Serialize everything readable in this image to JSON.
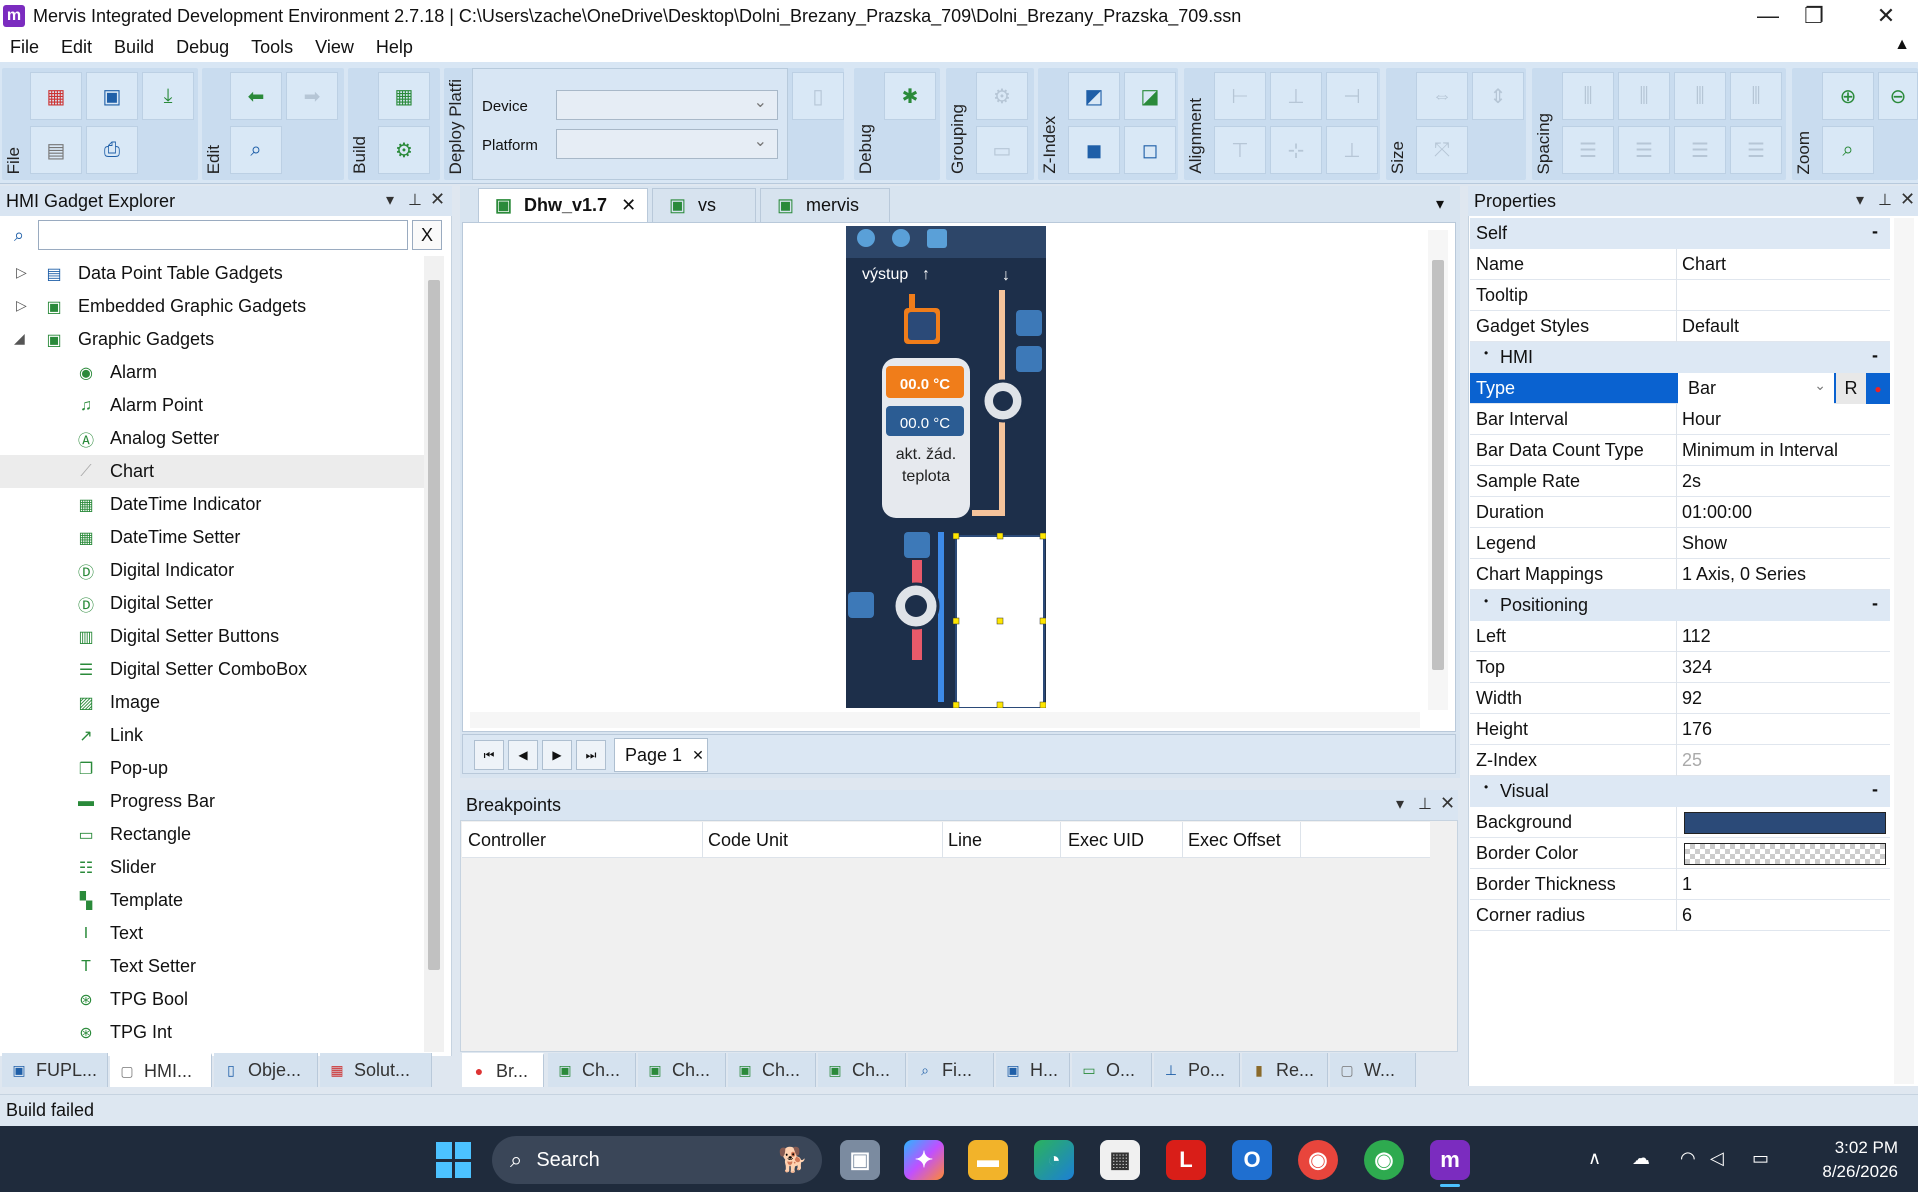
{
  "window": {
    "title": "Mervis Integrated Development Environment 2.7.18 | C:\\Users\\zache\\OneDrive\\Desktop\\Dolni_Brezany_Prazska_709\\Dolni_Brezany_Prazska_709.ssn",
    "logo": "m",
    "minimize": "—",
    "maximize": "❐",
    "close": "✕"
  },
  "menu": [
    "File",
    "Edit",
    "Build",
    "Debug",
    "Tools",
    "View",
    "Help"
  ],
  "menu_collapse": "▲",
  "toolbar": {
    "groups": [
      "File",
      "Edit",
      "Build",
      "Deploy Platfi",
      "Debug",
      "Grouping",
      "Z-Index",
      "Alignment",
      "Size",
      "Spacing",
      "Zoom"
    ],
    "device_label": "Device",
    "platform_label": "Platform",
    "device_value": "",
    "platform_value": ""
  },
  "left_panel": {
    "title": "HMI Gadget Explorer",
    "search_value": "",
    "clear_label": "X",
    "tree": {
      "group1": "Data Point Table Gadgets",
      "group2": "Embedded Graphic Gadgets",
      "group3": "Graphic Gadgets",
      "items": [
        "Alarm",
        "Alarm Point",
        "Analog Setter",
        "Chart",
        "DateTime Indicator",
        "DateTime Setter",
        "Digital Indicator",
        "Digital Setter",
        "Digital Setter Buttons",
        "Digital Setter ComboBox",
        "Image",
        "Link",
        "Pop-up",
        "Progress Bar",
        "Rectangle",
        "Slider",
        "Template",
        "Text",
        "Text Setter",
        "TPG Bool",
        "TPG Int"
      ]
    },
    "bottom_tabs": [
      "FUPL...",
      "HMI...",
      "Obje...",
      "Solut..."
    ]
  },
  "document": {
    "tabs": [
      "Dhw_v1.7",
      "vs",
      "mervis"
    ],
    "canvas": {
      "vystup": "výstup",
      "temp1": "00.0 °C",
      "temp2": "00.0 °C",
      "label_line1": "akt. žád.",
      "label_line2": "teplota"
    },
    "page_tab": "Page 1",
    "page_close": "✕"
  },
  "breakpoints": {
    "title": "Breakpoints",
    "columns": [
      "Controller",
      "Code Unit",
      "Line",
      "Exec UID",
      "Exec Offset"
    ],
    "bottom_tabs": [
      "Br...",
      "Ch...",
      "Ch...",
      "Ch...",
      "Ch...",
      "Fi...",
      "H...",
      "O...",
      "Po...",
      "Re...",
      "W..."
    ]
  },
  "properties": {
    "title": "Properties",
    "self_cat": "Self",
    "name_label": "Name",
    "name_value": "Chart",
    "tooltip_label": "Tooltip",
    "tooltip_value": "",
    "gstyles_label": "Gadget Styles",
    "gstyles_value": "Default",
    "hmi_cat": "HMI",
    "type_label": "Type",
    "type_value": "Bar",
    "type_r": "R",
    "barint_label": "Bar Interval",
    "barint_value": "Hour",
    "bardct_label": "Bar Data Count Type",
    "bardct_value": "Minimum in Interval",
    "srate_label": "Sample Rate",
    "srate_value": "2s",
    "dur_label": "Duration",
    "dur_value": "01:00:00",
    "legend_label": "Legend",
    "legend_value": "Show",
    "cmap_label": "Chart Mappings",
    "cmap_value": "1 Axis, 0 Series",
    "pos_cat": "Positioning",
    "left_label": "Left",
    "left_value": "112",
    "top_label": "Top",
    "top_value": "324",
    "width_label": "Width",
    "width_value": "92",
    "height_label": "Height",
    "height_value": "176",
    "zindex_label": "Z-Index",
    "zindex_value": "25",
    "vis_cat": "Visual",
    "bg_label": "Background",
    "bg_color": "#2b4a78",
    "bc_label": "Border Color",
    "bt_label": "Border Thickness",
    "bt_value": "1",
    "cr_label": "Corner radius",
    "cr_value": "6"
  },
  "status": {
    "text": "Build failed"
  },
  "taskbar": {
    "search_label": "Search",
    "time": "3:02 PM",
    "date": "8/26/2026"
  },
  "colors": {
    "accent": "#0a62d0",
    "hmi_bg": "#1d2f4a",
    "orange": "#f07d1a"
  }
}
